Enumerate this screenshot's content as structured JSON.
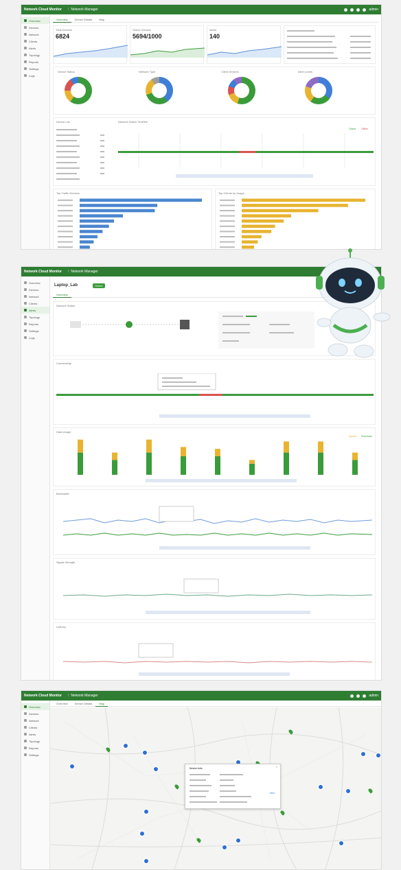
{
  "app": {
    "brand": "Network Cloud Monitor",
    "breadcrumb": "Network Manager",
    "user": "admin"
  },
  "sidebar": {
    "items": [
      "Overview",
      "Devices",
      "Network",
      "Clients",
      "Alerts",
      "Topology",
      "Reports",
      "Settings",
      "Logs"
    ]
  },
  "panel1": {
    "tabs": [
      "Overview",
      "Device Details",
      "Map"
    ],
    "stats": [
      {
        "label": "Total Devices",
        "value": "6824"
      },
      {
        "label": "Online Devices",
        "value": "5694/1000"
      },
      {
        "label": "Alerts",
        "value": "140"
      }
    ],
    "donuts": [
      "Device Status",
      "Network Type",
      "Client Devices",
      "Alert Levels"
    ],
    "timeline_label": "Network Status Timeline",
    "list_label": "Device List",
    "legend": [
      "Online",
      "Offline"
    ],
    "bar1_title": "Top Traffic Devices",
    "bar2_title": "Top Clients by Usage",
    "bar1_values": [
      96,
      61,
      59,
      34,
      27,
      23,
      18,
      14,
      11,
      8
    ],
    "bar2_values": [
      100,
      86,
      62,
      40,
      34,
      27,
      24,
      16,
      13,
      10
    ]
  },
  "panel2": {
    "device_name": "Laptop_Lab",
    "status": "Online",
    "tabs": [
      "Overview"
    ],
    "sections": [
      "Network Status",
      "Connectivity",
      "Data Usage",
      "Bandwidth",
      "Signal Strength",
      "Latency"
    ],
    "usage_values": [
      {
        "a": 24,
        "b": 14
      },
      {
        "a": 16,
        "b": 8
      },
      {
        "a": 24,
        "b": 14
      },
      {
        "a": 20,
        "b": 10
      },
      {
        "a": 20,
        "b": 8
      },
      {
        "a": 12,
        "b": 4
      },
      {
        "a": 24,
        "b": 12
      },
      {
        "a": 24,
        "b": 12
      },
      {
        "a": 16,
        "b": 8
      }
    ],
    "series_legend": [
      "Upload",
      "Download"
    ]
  },
  "panel3": {
    "tabs": [
      "Overview",
      "Device Details",
      "Map"
    ],
    "popup_title": "Device Info",
    "popup_action": "View"
  },
  "colors": {
    "primary": "#2e7d32",
    "blue": "#3f7fd6",
    "gold": "#e8b430",
    "red": "#d9534f"
  }
}
